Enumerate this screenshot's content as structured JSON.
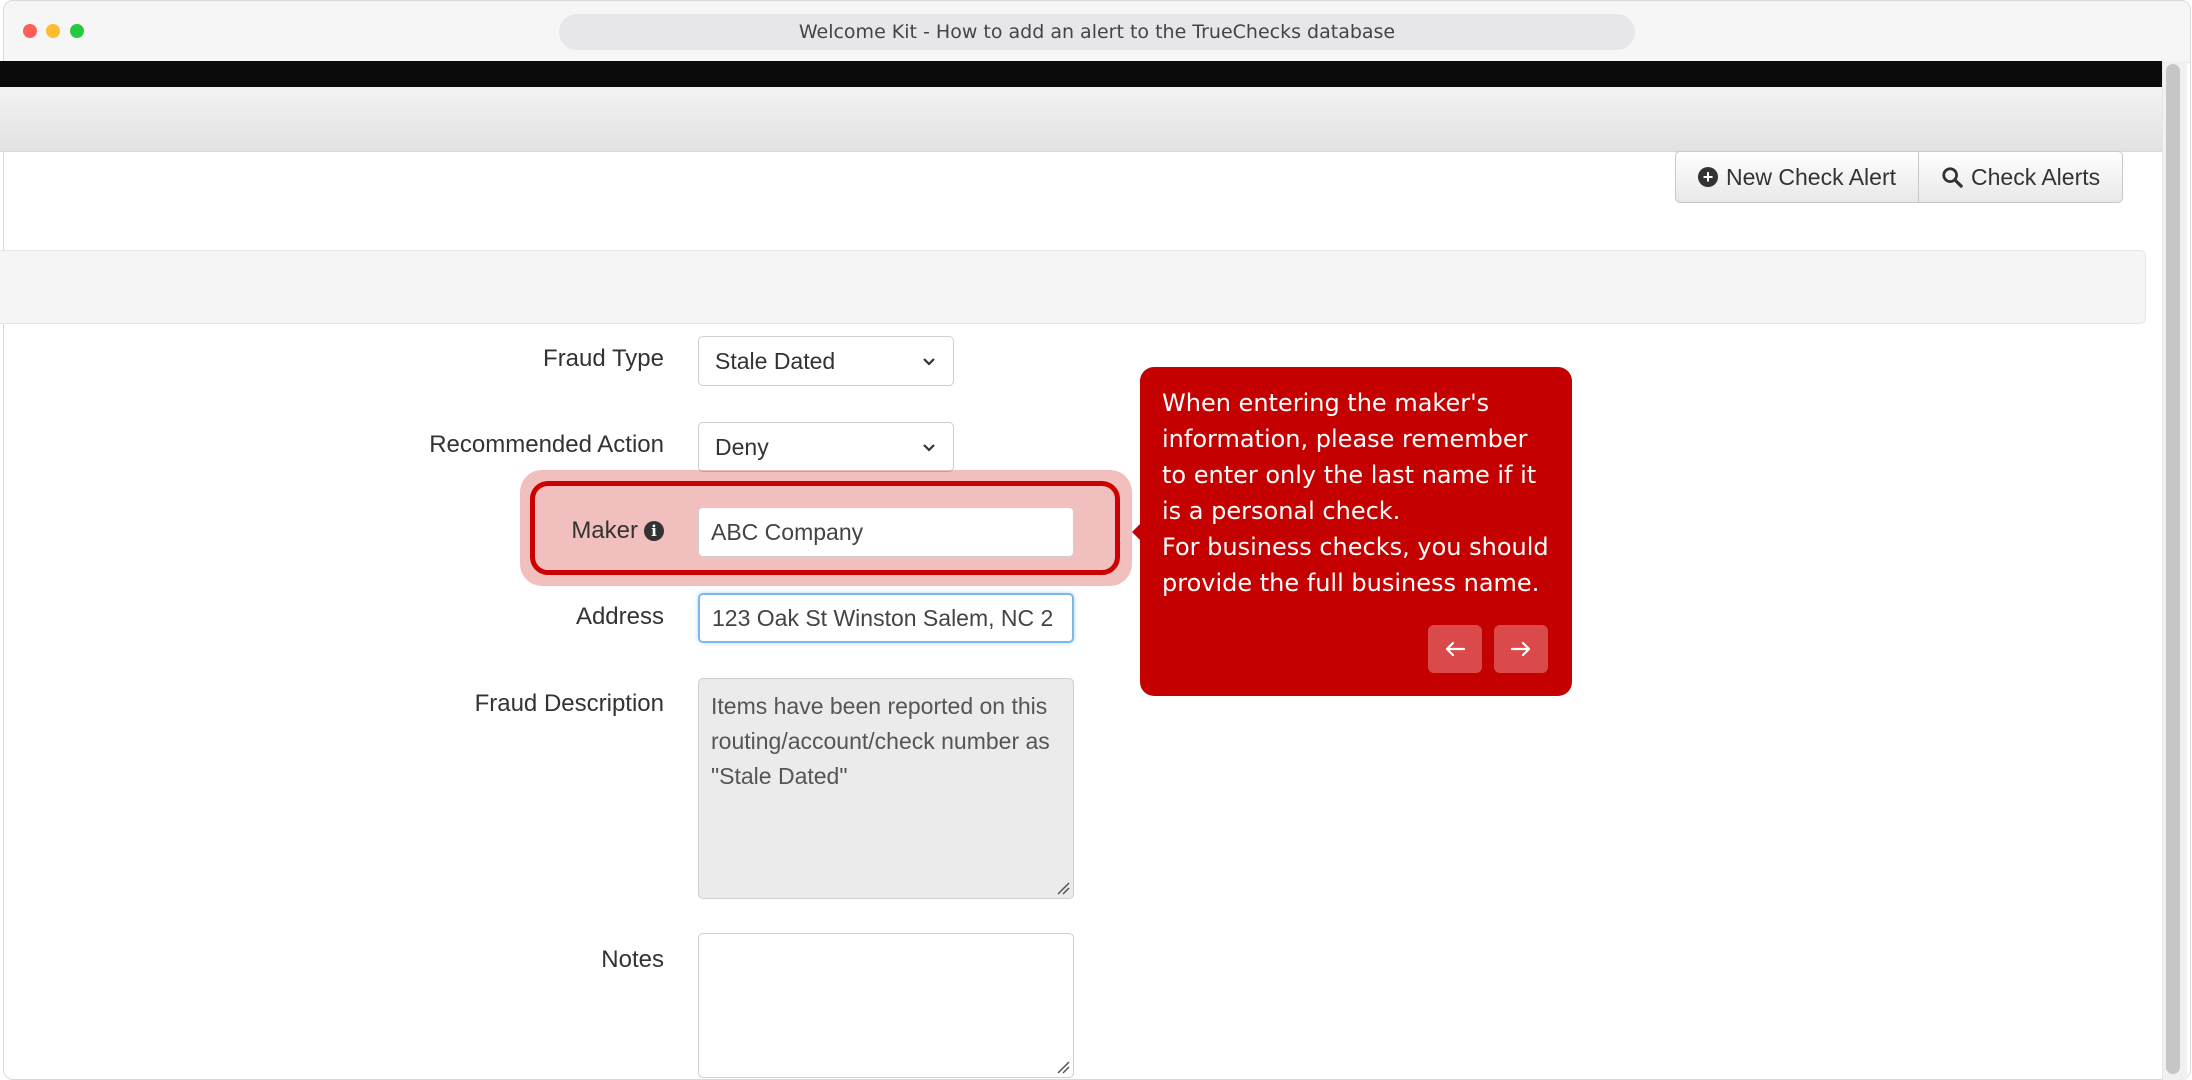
{
  "window": {
    "title": "Welcome Kit - How to add an alert to the TrueChecks database"
  },
  "toolbar": {
    "new_alert_label": "New Check Alert",
    "check_alerts_label": "Check Alerts"
  },
  "form": {
    "fraud_type": {
      "label": "Fraud Type",
      "value": "Stale Dated"
    },
    "recommended_action": {
      "label": "Recommended Action",
      "value": "Deny"
    },
    "maker": {
      "label": "Maker",
      "value": "ABC Company"
    },
    "address": {
      "label": "Address",
      "value": "123 Oak St Winston Salem, NC 2"
    },
    "fraud_description": {
      "label": "Fraud Description",
      "value": "Items have been reported on this routing/account/check number as \"Stale Dated\""
    },
    "notes": {
      "label": "Notes",
      "value": ""
    }
  },
  "tooltip": {
    "line1": "When entering the maker's information, please remember to enter only the last name if it is a personal check.",
    "line2": "For business checks, you should provide the full business name."
  },
  "colors": {
    "accent": "#c40000",
    "highlight": "#cc0000"
  }
}
